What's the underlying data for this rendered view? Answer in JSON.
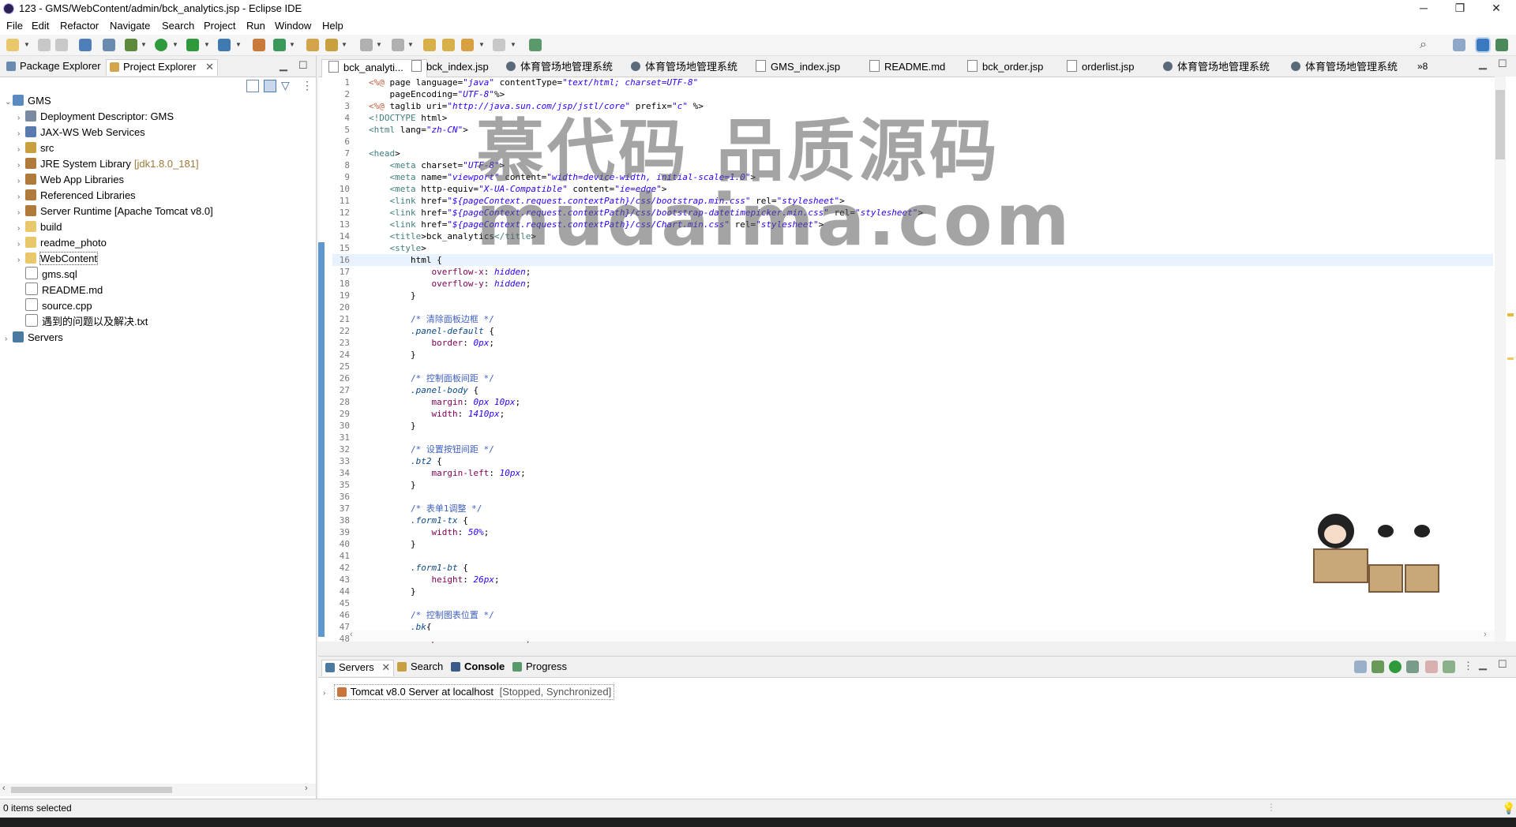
{
  "window": {
    "title": "123 - GMS/WebContent/admin/bck_analytics.jsp - Eclipse IDE",
    "controls": {
      "minimize": "─",
      "restore": "❐",
      "close": "✕"
    }
  },
  "menu": [
    "File",
    "Edit",
    "Refactor",
    "Navigate",
    "Search",
    "Project",
    "Run",
    "Window",
    "Help"
  ],
  "left_panel": {
    "tabs": [
      "Package Explorer",
      "Project Explorer"
    ],
    "active_tab": "Project Explorer",
    "project": "GMS",
    "tree": [
      {
        "label": "Deployment Descriptor: GMS",
        "decoration": "",
        "icon": "descriptor"
      },
      {
        "label": "JAX-WS Web Services",
        "decoration": "",
        "icon": "webservice"
      },
      {
        "label": "src",
        "decoration": "",
        "icon": "package-folder"
      },
      {
        "label": "JRE System Library",
        "decoration": "[jdk1.8.0_181]",
        "icon": "library"
      },
      {
        "label": "Web App Libraries",
        "decoration": "",
        "icon": "library"
      },
      {
        "label": "Referenced Libraries",
        "decoration": "",
        "icon": "library"
      },
      {
        "label": "Server Runtime [Apache Tomcat v8.0]",
        "decoration": "",
        "icon": "library"
      },
      {
        "label": "build",
        "decoration": "",
        "icon": "folder"
      },
      {
        "label": "readme_photo",
        "decoration": "",
        "icon": "folder"
      },
      {
        "label": "WebContent",
        "decoration": "",
        "icon": "folder"
      },
      {
        "label": "gms.sql",
        "decoration": "",
        "icon": "file"
      },
      {
        "label": "README.md",
        "decoration": "",
        "icon": "file"
      },
      {
        "label": "source.cpp",
        "decoration": "",
        "icon": "file"
      },
      {
        "label": "遇到的问题以及解决.txt",
        "decoration": "",
        "icon": "file"
      }
    ],
    "servers_label": "Servers"
  },
  "editor_tabs": [
    {
      "label": "bck_analyti...",
      "icon": "file",
      "active": true
    },
    {
      "label": "bck_index.jsp",
      "icon": "file",
      "active": false
    },
    {
      "label": "体育管场地管理系统",
      "icon": "globe",
      "active": false
    },
    {
      "label": "体育管场地管理系统",
      "icon": "globe",
      "active": false
    },
    {
      "label": "GMS_index.jsp",
      "icon": "file",
      "active": false
    },
    {
      "label": "README.md",
      "icon": "file",
      "active": false
    },
    {
      "label": "bck_order.jsp",
      "icon": "file",
      "active": false
    },
    {
      "label": "orderlist.jsp",
      "icon": "file",
      "active": false
    },
    {
      "label": "体育管场地管理系统",
      "icon": "globe",
      "active": false
    },
    {
      "label": "体育管场地管理系统",
      "icon": "globe",
      "active": false
    }
  ],
  "overflow_count": "»8",
  "watermark": {
    "line1": "慕代码 品质源码",
    "line2": "mudaima.com"
  },
  "code_lines": [
    {
      "n": "1",
      "t": "<%@ page language=\"java\" contentType=\"text/html; charset=UTF-8\""
    },
    {
      "n": "2",
      "t": "    pageEncoding=\"UTF-8\"%>"
    },
    {
      "n": "3",
      "t": "<%@ taglib uri=\"http://java.sun.com/jsp/jstl/core\" prefix=\"c\" %>"
    },
    {
      "n": "4",
      "t": "<!DOCTYPE html>"
    },
    {
      "n": "5",
      "t": "<html lang=\"zh-CN\">"
    },
    {
      "n": "6",
      "t": ""
    },
    {
      "n": "7",
      "t": "<head>"
    },
    {
      "n": "8",
      "t": "    <meta charset=\"UTF-8\">"
    },
    {
      "n": "9",
      "t": "    <meta name=\"viewport\" content=\"width=device-width, initial-scale=1.0\">"
    },
    {
      "n": "10",
      "t": "    <meta http-equiv=\"X-UA-Compatible\" content=\"ie=edge\">"
    },
    {
      "n": "11",
      "t": "    <link href=\"${pageContext.request.contextPath}/css/bootstrap.min.css\" rel=\"stylesheet\">"
    },
    {
      "n": "12",
      "t": "    <link href=\"${pageContext.request.contextPath}/css/bootstrap-datetimepicker.min.css\" rel=\"stylesheet\">"
    },
    {
      "n": "13",
      "t": "    <link href=\"${pageContext.request.contextPath}/css/Chart.min.css\" rel=\"stylesheet\">"
    },
    {
      "n": "14",
      "t": "    <title>bck_analytics</title>"
    },
    {
      "n": "15",
      "t": "    <style>"
    },
    {
      "n": "16",
      "t": "        html {"
    },
    {
      "n": "17",
      "t": "            overflow-x: hidden;"
    },
    {
      "n": "18",
      "t": "            overflow-y: hidden;"
    },
    {
      "n": "19",
      "t": "        }"
    },
    {
      "n": "20",
      "t": ""
    },
    {
      "n": "21",
      "t": "        /* 清除面板边框 */"
    },
    {
      "n": "22",
      "t": "        .panel-default {"
    },
    {
      "n": "23",
      "t": "            border: 0px;"
    },
    {
      "n": "24",
      "t": "        }"
    },
    {
      "n": "25",
      "t": ""
    },
    {
      "n": "26",
      "t": "        /* 控制面板间距 */"
    },
    {
      "n": "27",
      "t": "        .panel-body {"
    },
    {
      "n": "28",
      "t": "            margin: 0px 10px;"
    },
    {
      "n": "29",
      "t": "            width: 1410px;"
    },
    {
      "n": "30",
      "t": "        }"
    },
    {
      "n": "31",
      "t": ""
    },
    {
      "n": "32",
      "t": "        /* 设置按钮间距 */"
    },
    {
      "n": "33",
      "t": "        .bt2 {"
    },
    {
      "n": "34",
      "t": "            margin-left: 10px;"
    },
    {
      "n": "35",
      "t": "        }"
    },
    {
      "n": "36",
      "t": ""
    },
    {
      "n": "37",
      "t": "        /* 表单1调整 */"
    },
    {
      "n": "38",
      "t": "        .form1-tx {"
    },
    {
      "n": "39",
      "t": "            width: 50%;"
    },
    {
      "n": "40",
      "t": "        }"
    },
    {
      "n": "41",
      "t": ""
    },
    {
      "n": "42",
      "t": "        .form1-bt {"
    },
    {
      "n": "43",
      "t": "            height: 26px;"
    },
    {
      "n": "44",
      "t": "        }"
    },
    {
      "n": "45",
      "t": ""
    },
    {
      "n": "46",
      "t": "        /* 控制图表位置 */"
    },
    {
      "n": "47",
      "t": "        .bk{"
    },
    {
      "n": "48",
      "t": "            position: absolute;"
    }
  ],
  "bottom_panel": {
    "tabs": [
      "Servers",
      "Search",
      "Console",
      "Progress"
    ],
    "active_tab": "Servers",
    "server_entry": "Tomcat v8.0 Server at localhost",
    "server_status": "[Stopped, Synchronized]"
  },
  "status": {
    "selection": "0 items selected"
  },
  "colors": {
    "accent": "#5e98cf",
    "current_line": "#e8f2fe",
    "watermark": "#5a5a5a"
  }
}
